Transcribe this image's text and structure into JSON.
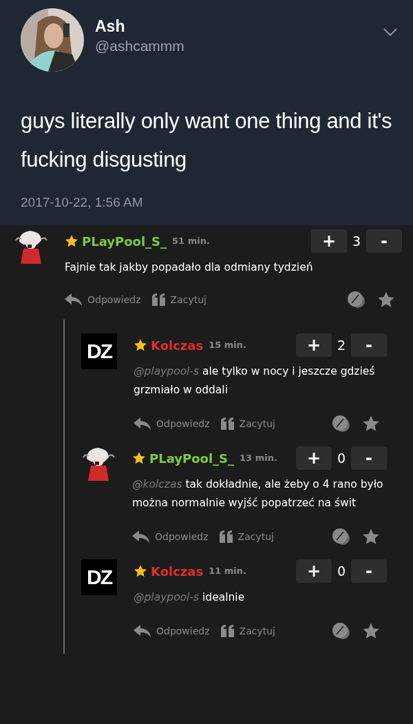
{
  "tweet": {
    "name": "Ash",
    "handle": "@ashcammm",
    "text": "guys literally only want one thing and it's fucking disgusting",
    "time": "2017-10-22, 1:56 AM"
  },
  "comments": [
    {
      "avatar": {
        "kind": "figure"
      },
      "author": "PLayPool_S_",
      "color": "#7ac943",
      "time": "51 min.",
      "score": "3",
      "plus": "+",
      "minus": "-",
      "text": "Fajnie tak jakby popadało dla odmiany tydzień",
      "reply": "Odpowiedz",
      "quote": "Zacytuj",
      "children": [
        {
          "avatar": {
            "kind": "initials",
            "text": "DZ"
          },
          "author": "Kolczas",
          "color": "#e32b2b",
          "time": "15 min.",
          "score": "2",
          "plus": "+",
          "minus": "-",
          "mention": "@playpool-s",
          "text": "ale tylko w nocy i jeszcze gdzieś grzmiało w oddali",
          "reply": "Odpowiedz",
          "quote": "Zacytuj"
        },
        {
          "avatar": {
            "kind": "figure"
          },
          "author": "PLayPool_S_",
          "color": "#7ac943",
          "time": "13 min.",
          "score": "0",
          "plus": "+",
          "minus": "-",
          "mention": "@kolczas",
          "text": "tak dokładnie, ale żeby o 4 rano było można normalnie wyjść popatrzeć na świt",
          "reply": "Odpowiedz",
          "quote": "Zacytuj"
        },
        {
          "avatar": {
            "kind": "initials",
            "text": "DZ"
          },
          "author": "Kolczas",
          "color": "#e32b2b",
          "time": "11 min.",
          "score": "0",
          "plus": "+",
          "minus": "-",
          "mention": "@playpool-s",
          "text": "idealnie",
          "reply": "Odpowiedz",
          "quote": "Zacytuj"
        }
      ]
    }
  ]
}
